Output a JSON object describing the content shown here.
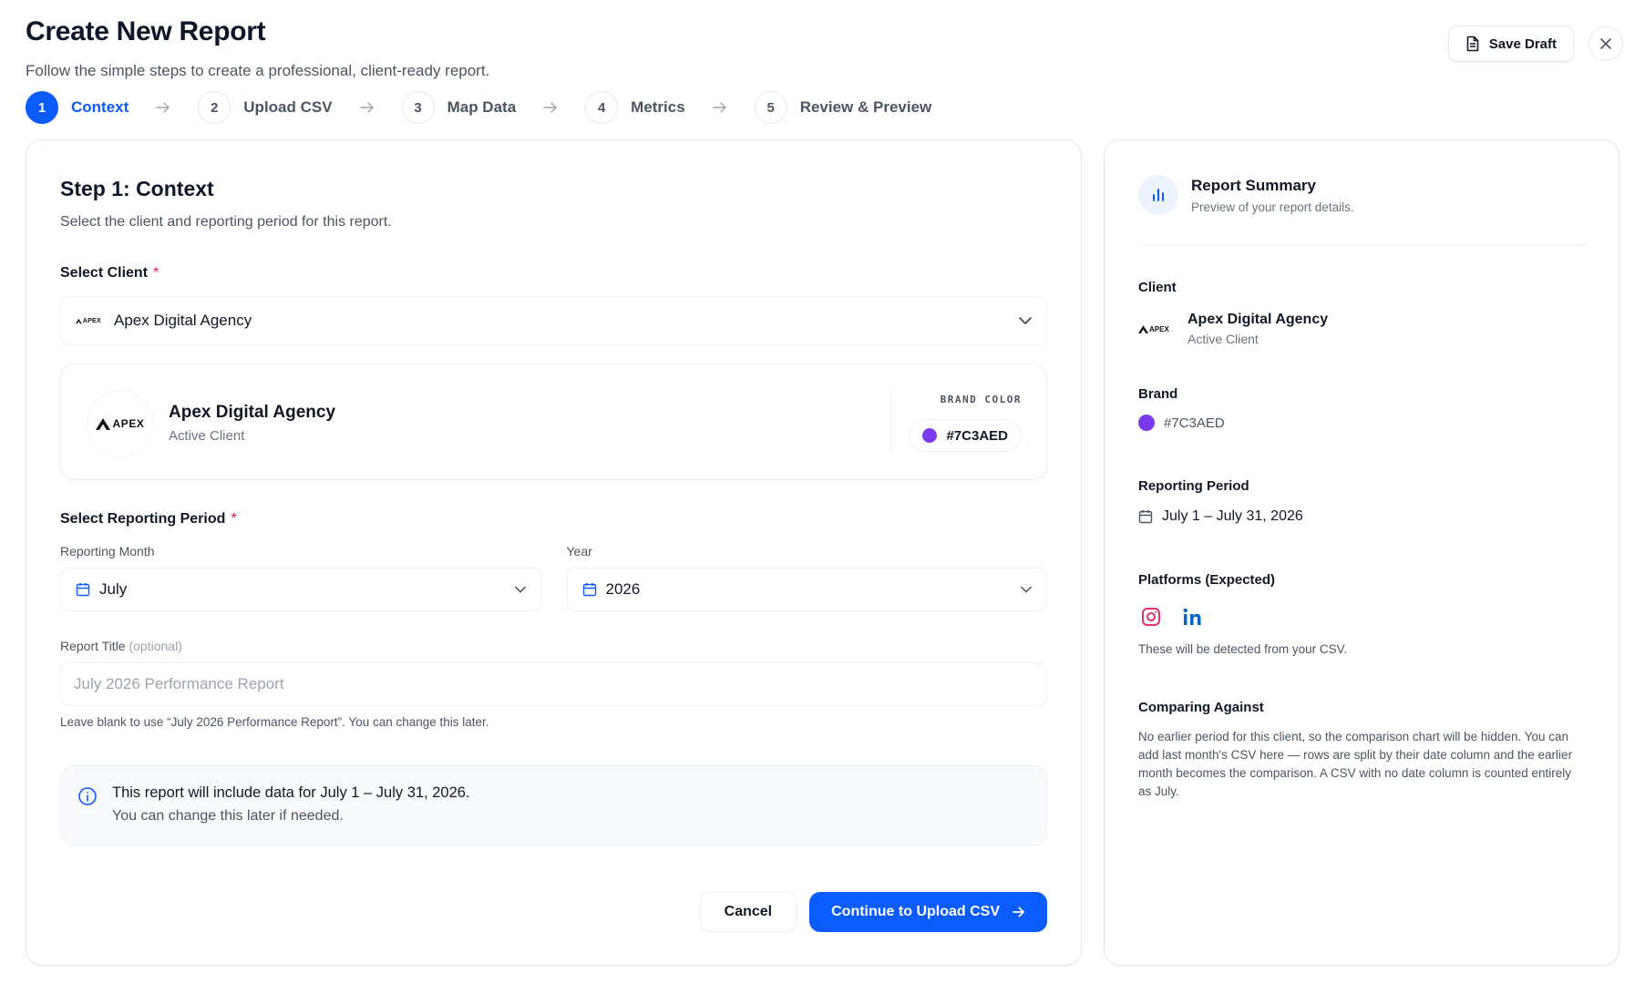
{
  "header": {
    "title": "Create New Report",
    "subtitle": "Follow the simple steps to create a professional, client-ready report.",
    "save_draft_label": "Save Draft"
  },
  "steps": [
    {
      "num": "1",
      "label": "Context",
      "active": true
    },
    {
      "num": "2",
      "label": "Upload CSV",
      "active": false
    },
    {
      "num": "3",
      "label": "Map Data",
      "active": false
    },
    {
      "num": "4",
      "label": "Metrics",
      "active": false
    },
    {
      "num": "5",
      "label": "Review & Preview",
      "active": false
    }
  ],
  "main": {
    "title": "Step 1: Context",
    "subtitle": "Select the client and reporting period for this report.",
    "client_label": "Select Client",
    "required_mark": "*",
    "client_value": "Apex Digital Agency",
    "client_card": {
      "logo_text": "APEX",
      "name": "Apex Digital Agency",
      "status": "Active Client",
      "brand_label": "BRAND COLOR",
      "brand_value": "#7C3AED",
      "brand_color": "#7C3AED"
    },
    "period_label": "Select Reporting Period",
    "month_label": "Reporting Month",
    "month_value": "July",
    "year_label": "Year",
    "year_value": "2026",
    "report_title_label": "Report Title",
    "report_title_optional": "(optional)",
    "report_title_placeholder": "July 2026 Performance Report",
    "report_title_hint": "Leave blank to use “July 2026 Performance Report”. You can change this later.",
    "info_line1": "This report will include data for July 1 – July 31, 2026.",
    "info_line2": "You can change this later if needed.",
    "cancel_label": "Cancel",
    "continue_label": "Continue to Upload CSV"
  },
  "summary": {
    "title": "Report Summary",
    "subtitle": "Preview of your report details.",
    "client_label": "Client",
    "client_logo_text": "APEX",
    "client_name": "Apex Digital Agency",
    "client_status": "Active Client",
    "brand_label": "Brand",
    "brand_value": "#7C3AED",
    "period_label": "Reporting Period",
    "period_value": "July 1 – July 31, 2026",
    "platforms_label": "Platforms (Expected)",
    "platforms": [
      "instagram-icon",
      "linkedin-icon"
    ],
    "platforms_hint": "These will be detected from your CSV.",
    "comparing_label": "Comparing Against",
    "comparing_text": "No earlier period for this client, so the comparison chart will be hidden. You can add last month's CSV here — rows are split by their date column and the earlier month becomes the comparison. A CSV with no date column is counted entirely as July."
  },
  "colors": {
    "accent": "#0B5CFF",
    "brand": "#7C3AED",
    "required": "#E11D48"
  }
}
